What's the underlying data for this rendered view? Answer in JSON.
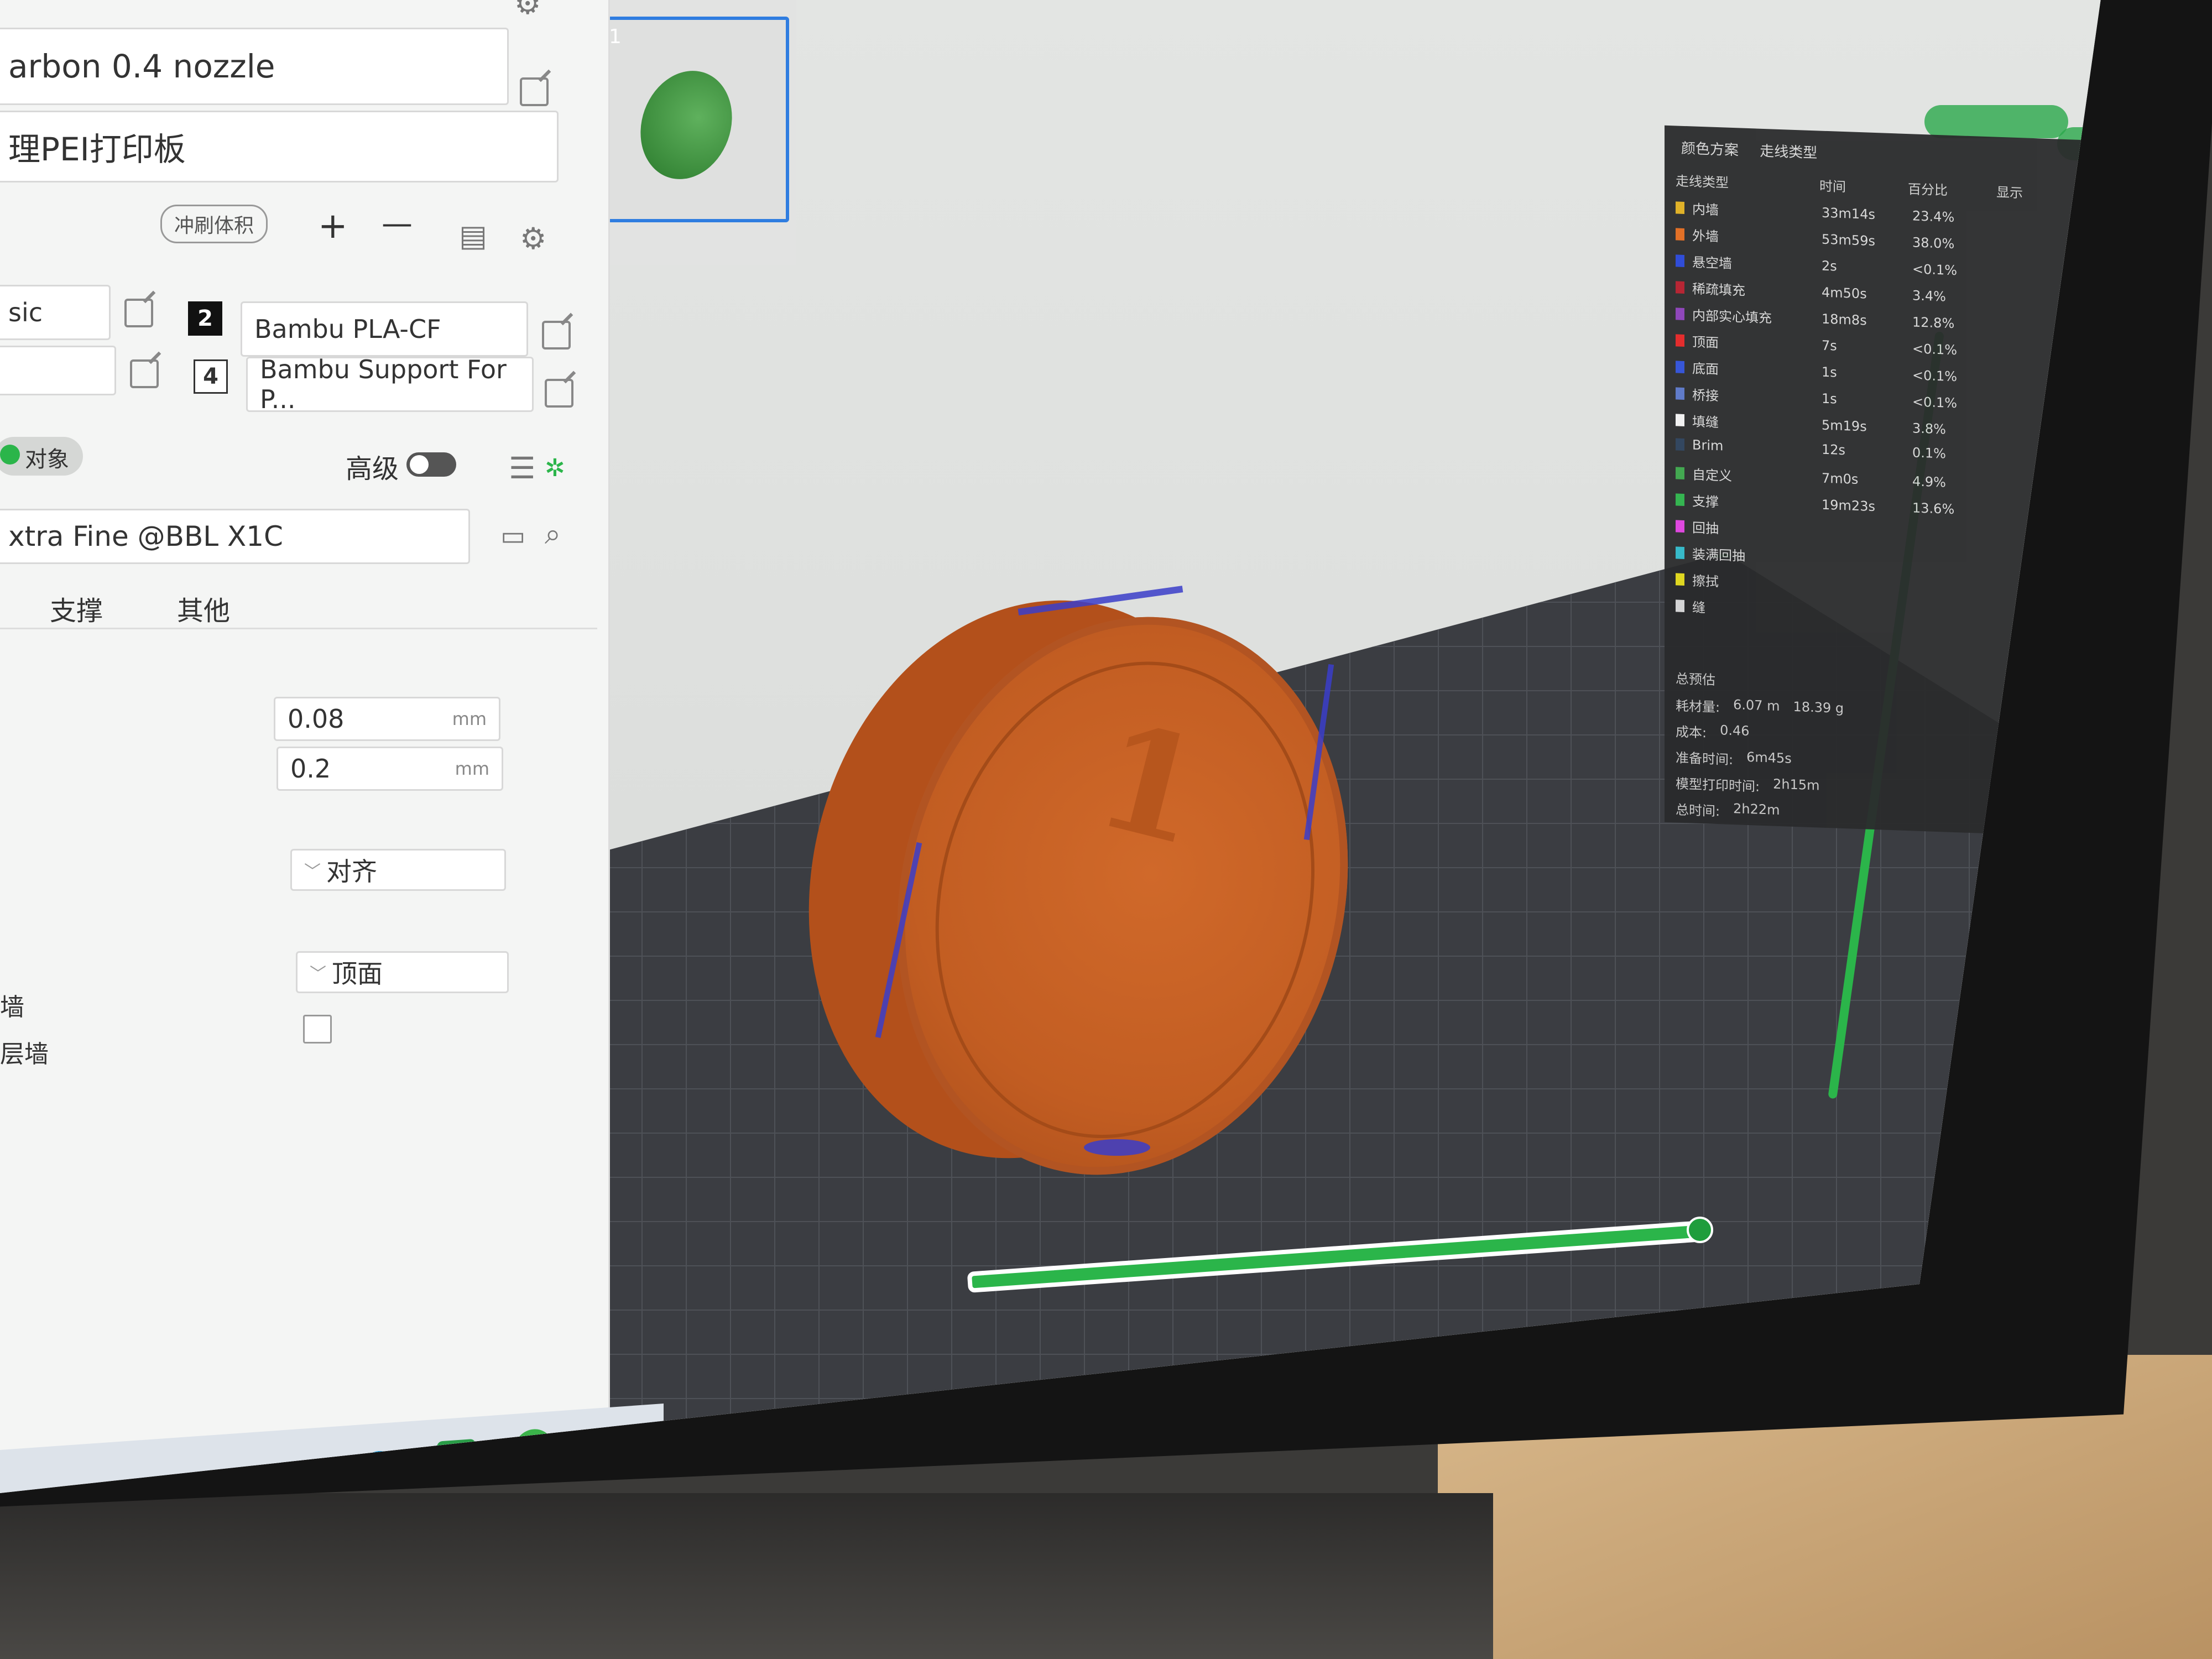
{
  "window": {
    "title_fragment": "设置"
  },
  "printer": {
    "nozzle": "arbon 0.4 nozzle",
    "plate": "理PEI打印板"
  },
  "toolbar": {
    "flush_volume_label": "冲刷体积",
    "add_label": "+",
    "remove_label": "—"
  },
  "filaments": [
    {
      "slot": "2",
      "name": "Bambu PLA-CF",
      "left_value": "sic"
    },
    {
      "slot": "4",
      "name": "Bambu Support For P...",
      "left_value": ""
    }
  ],
  "process": {
    "mode_label": "对象",
    "advanced_label": "高级",
    "advanced_on": false,
    "profile": "xtra Fine @BBL X1C",
    "tabs": [
      "支撑",
      "其他"
    ],
    "layer_height": "0.08",
    "first_layer_height": "0.2",
    "unit": "mm",
    "seam_label": "对齐",
    "top_surface_label": "顶面",
    "wall_label_1": "墙",
    "wall_label_2": "层墙"
  },
  "legend": {
    "scheme_label": "颜色方案",
    "scheme_value": "走线类型",
    "columns": [
      "走线类型",
      "时间",
      "百分比",
      "显示"
    ],
    "rows": [
      {
        "name": "内墙",
        "time": "33m14s",
        "pct": "23.4%",
        "color": "#e0b020"
      },
      {
        "name": "外墙",
        "time": "53m59s",
        "pct": "38.0%",
        "color": "#e36a1e"
      },
      {
        "name": "悬空墙",
        "time": "2s",
        "pct": "<0.1%",
        "color": "#2746d8"
      },
      {
        "name": "稀疏填充",
        "time": "4m50s",
        "pct": "3.4%",
        "color": "#b51c2b"
      },
      {
        "name": "内部实心填充",
        "time": "18m8s",
        "pct": "12.8%",
        "color": "#8b3fb8"
      },
      {
        "name": "顶面",
        "time": "7s",
        "pct": "<0.1%",
        "color": "#e52424"
      },
      {
        "name": "底面",
        "time": "1s",
        "pct": "<0.1%",
        "color": "#2f4fd8"
      },
      {
        "name": "桥接",
        "time": "1s",
        "pct": "<0.1%",
        "color": "#5a76c8"
      },
      {
        "name": "填缝",
        "time": "5m19s",
        "pct": "3.8%",
        "color": "#f2f2f2"
      },
      {
        "name": "Brim",
        "time": "12s",
        "pct": "0.1%",
        "color": "#2a3f5a"
      },
      {
        "name": "自定义",
        "time": "7m0s",
        "pct": "4.9%",
        "color": "#3ba64a"
      },
      {
        "name": "支撑",
        "time": "19m23s",
        "pct": "13.6%",
        "color": "#2cb34a"
      },
      {
        "name": "回抽",
        "time": "",
        "pct": "",
        "color": "#e040e0"
      },
      {
        "name": "装满回抽",
        "time": "",
        "pct": "",
        "color": "#2fb8c8"
      },
      {
        "name": "擦拭",
        "time": "",
        "pct": "",
        "color": "#e8e020"
      },
      {
        "name": "缝",
        "time": "",
        "pct": "",
        "color": "#dddddd"
      }
    ],
    "summary_title": "总预估",
    "summary": [
      {
        "label": "耗材量:",
        "value": "6.07 m",
        "extra": "18.39 g"
      },
      {
        "label": "成本:",
        "value": "0.46",
        "extra": ""
      },
      {
        "label": "准备时间:",
        "value": "6m45s",
        "extra": ""
      },
      {
        "label": "模型打印时间:",
        "value": "2h15m",
        "extra": ""
      },
      {
        "label": "总时间:",
        "value": "2h22m",
        "extra": ""
      }
    ]
  },
  "model": {
    "coin_numeral": "1"
  },
  "thumbnail": {
    "index": "1"
  },
  "colors": {
    "accent": "#2bb54a",
    "selected_border": "#2f7de0",
    "model": "#c96226"
  }
}
